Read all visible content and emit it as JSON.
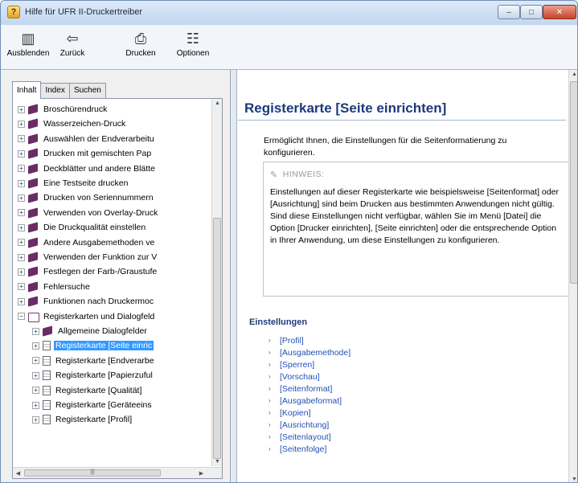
{
  "window": {
    "title": "Hilfe für UFR II-Druckertreiber"
  },
  "toolbar": {
    "buttons": [
      {
        "label": "Ausblenden",
        "icon": "hide-pane-icon"
      },
      {
        "label": "Zurück",
        "icon": "back-arrow-icon"
      },
      {
        "label": "Drucken",
        "icon": "printer-icon"
      },
      {
        "label": "Optionen",
        "icon": "options-icon"
      }
    ]
  },
  "tabs": [
    {
      "label": "Inhalt",
      "active": true
    },
    {
      "label": "Index",
      "active": false
    },
    {
      "label": "Suchen",
      "active": false
    }
  ],
  "tree": [
    {
      "label": "Broschürendruck",
      "level": 0,
      "type": "book"
    },
    {
      "label": "Wasserzeichen-Druck",
      "level": 0,
      "type": "book"
    },
    {
      "label": "Auswählen der Endverarbeitu",
      "level": 0,
      "type": "book"
    },
    {
      "label": "Drucken mit gemischten Pap",
      "level": 0,
      "type": "book"
    },
    {
      "label": "Deckblätter und andere Blätte",
      "level": 0,
      "type": "book"
    },
    {
      "label": "Eine Testseite drucken",
      "level": 0,
      "type": "book"
    },
    {
      "label": "Drucken von Seriennummern",
      "level": 0,
      "type": "book"
    },
    {
      "label": "Verwenden von Overlay-Druck",
      "level": 0,
      "type": "book"
    },
    {
      "label": "Die Druckqualität einstellen",
      "level": 0,
      "type": "book"
    },
    {
      "label": "Andere Ausgabemethoden ve",
      "level": 0,
      "type": "book"
    },
    {
      "label": "Verwenden der Funktion zur V",
      "level": 0,
      "type": "book"
    },
    {
      "label": "Festlegen der Farb-/Graustufe",
      "level": 0,
      "type": "book"
    },
    {
      "label": "Fehlersuche",
      "level": 0,
      "type": "book"
    },
    {
      "label": "Funktionen nach Druckermoc",
      "level": 0,
      "type": "book"
    },
    {
      "label": "Registerkarten und Dialogfeld",
      "level": 0,
      "type": "book-open"
    },
    {
      "label": "Allgemeine Dialogfelder",
      "level": 1,
      "type": "book"
    },
    {
      "label": "Registerkarte [Seite einric",
      "level": 1,
      "type": "page",
      "selected": true
    },
    {
      "label": "Registerkarte [Endverarbe",
      "level": 1,
      "type": "page"
    },
    {
      "label": "Registerkarte [Papierzuful",
      "level": 1,
      "type": "page"
    },
    {
      "label": "Registerkarte [Qualität]",
      "level": 1,
      "type": "page"
    },
    {
      "label": "Registerkarte [Geräteeins",
      "level": 1,
      "type": "page"
    },
    {
      "label": "Registerkarte [Profil]",
      "level": 1,
      "type": "page"
    }
  ],
  "doc": {
    "title": "Registerkarte [Seite einrichten]",
    "intro": "Ermöglicht Ihnen, die Einstellungen für die Seitenformatierung zu konfigurieren.",
    "note": {
      "heading": "HINWEIS:",
      "text": "Einstellungen auf dieser Registerkarte wie beispielsweise [Seitenformat] oder [Ausrichtung] sind beim Drucken aus bestimmten Anwendungen nicht gültig. Sind diese Einstellungen nicht verfügbar, wählen Sie im Menü [Datei] die Option [Drucker einrichten], [Seite einrichten] oder die entsprechende Option in Ihrer Anwendung, um diese Einstellungen zu konfigurieren."
    },
    "section_title": "Einstellungen",
    "links": [
      "[Profil]",
      "[Ausgabemethode]",
      "[Sperren]",
      "[Vorschau]",
      "[Seitenformat]",
      "[Ausgabeformat]",
      "[Kopien]",
      "[Ausrichtung]",
      "[Seitenlayout]",
      "[Seitenfolge]"
    ]
  },
  "colors": {
    "accent": "#1c3a7c",
    "link": "#2450b5",
    "selection": "#3399ff"
  }
}
